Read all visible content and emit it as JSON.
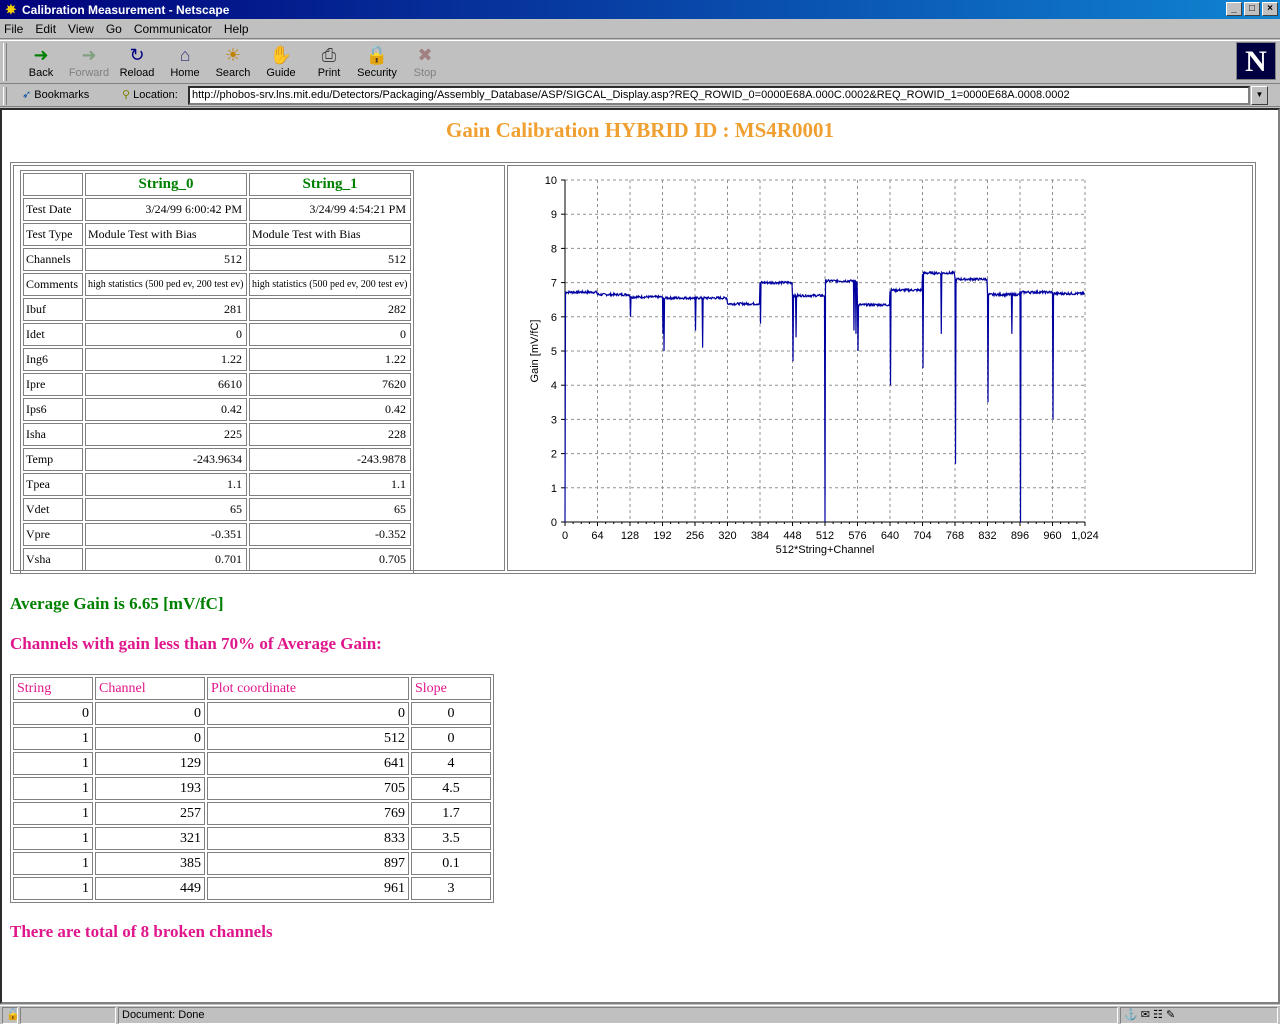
{
  "window": {
    "title": "Calibration Measurement - Netscape"
  },
  "menu": [
    "File",
    "Edit",
    "View",
    "Go",
    "Communicator",
    "Help"
  ],
  "toolbar": [
    {
      "label": "Back",
      "icon": "back-arrow-icon",
      "glyph": "➜",
      "color": "#008000",
      "enabled": true
    },
    {
      "label": "Forward",
      "icon": "forward-arrow-icon",
      "glyph": "➜",
      "color": "#80a080",
      "enabled": false
    },
    {
      "label": "Reload",
      "icon": "reload-icon",
      "glyph": "↻",
      "color": "#000080",
      "enabled": true
    },
    {
      "label": "Home",
      "icon": "home-icon",
      "glyph": "⌂",
      "color": "#404080",
      "enabled": true
    },
    {
      "label": "Search",
      "icon": "search-icon",
      "glyph": "☀",
      "color": "#c08000",
      "enabled": true
    },
    {
      "label": "Guide",
      "icon": "guide-icon",
      "glyph": "✋",
      "color": "#4060c0",
      "enabled": true
    },
    {
      "label": "Print",
      "icon": "print-icon",
      "glyph": "⎙",
      "color": "#404040",
      "enabled": true
    },
    {
      "label": "Security",
      "icon": "lock-icon",
      "glyph": "🔒",
      "color": "#c0a000",
      "enabled": true
    },
    {
      "label": "Stop",
      "icon": "stop-icon",
      "glyph": "✖",
      "color": "#a08080",
      "enabled": false
    }
  ],
  "location": {
    "bookmarks_label": "Bookmarks",
    "location_label": "Location:",
    "url": "http://phobos-srv.lns.mit.edu/Detectors/Packaging/Assembly_Database/ASP/SIGCAL_Display.asp?REQ_ROWID_0=0000E68A.000C.0002&REQ_ROWID_1=0000E68A.0008.0002"
  },
  "page": {
    "title": "Gain Calibration HYBRID ID : MS4R0001",
    "info_headers": [
      "String_0",
      "String_1"
    ],
    "info_rows": [
      {
        "label": "Test Date",
        "v0": "3/24/99 6:00:42 PM",
        "v1": "3/24/99 4:54:21 PM",
        "align": "right"
      },
      {
        "label": "Test Type",
        "v0": "Module Test with Bias",
        "v1": "Module Test with Bias",
        "align": "left"
      },
      {
        "label": "Channels",
        "v0": "512",
        "v1": "512",
        "align": "right"
      },
      {
        "label": "Comments",
        "v0": "high statistics (500 ped ev, 200 test ev)",
        "v1": "high statistics (500 ped ev, 200 test ev)",
        "align": "small"
      },
      {
        "label": "Ibuf",
        "v0": "281",
        "v1": "282",
        "align": "right"
      },
      {
        "label": "Idet",
        "v0": "0",
        "v1": "0",
        "align": "right"
      },
      {
        "label": "Ing6",
        "v0": "1.22",
        "v1": "1.22",
        "align": "right"
      },
      {
        "label": "Ipre",
        "v0": "6610",
        "v1": "7620",
        "align": "right"
      },
      {
        "label": "Ips6",
        "v0": "0.42",
        "v1": "0.42",
        "align": "right"
      },
      {
        "label": "Isha",
        "v0": "225",
        "v1": "228",
        "align": "right"
      },
      {
        "label": "Temp",
        "v0": "-243.9634",
        "v1": "-243.9878",
        "align": "right"
      },
      {
        "label": "Tpea",
        "v0": "1.1",
        "v1": "1.1",
        "align": "right"
      },
      {
        "label": "Vdet",
        "v0": "65",
        "v1": "65",
        "align": "right"
      },
      {
        "label": "Vpre",
        "v0": "-0.351",
        "v1": "-0.352",
        "align": "right"
      },
      {
        "label": "Vsha",
        "v0": "0.701",
        "v1": "0.705",
        "align": "right"
      }
    ],
    "average": "Average Gain is 6.65 [mV/fC]",
    "low_header": "Channels with gain less than 70% of Average Gain:",
    "low_columns": [
      "String",
      "Channel",
      "Plot coordinate",
      "Slope"
    ],
    "low_rows": [
      [
        "0",
        "0",
        "0",
        "0"
      ],
      [
        "1",
        "0",
        "512",
        "0"
      ],
      [
        "1",
        "129",
        "641",
        "4"
      ],
      [
        "1",
        "193",
        "705",
        "4.5"
      ],
      [
        "1",
        "257",
        "769",
        "1.7"
      ],
      [
        "1",
        "321",
        "833",
        "3.5"
      ],
      [
        "1",
        "385",
        "897",
        "0.1"
      ],
      [
        "1",
        "449",
        "961",
        "3"
      ]
    ],
    "total": "There are total of 8 broken channels"
  },
  "status": {
    "text": "Document: Done"
  },
  "chart_data": {
    "type": "line",
    "xlabel": "512*String+Channel",
    "ylabel": "Gain [mV/fC]",
    "xlim": [
      0,
      1024
    ],
    "ylim": [
      0,
      10
    ],
    "xticks": [
      "0",
      "64",
      "128",
      "192",
      "256",
      "320",
      "384",
      "448",
      "512",
      "576",
      "640",
      "704",
      "768",
      "832",
      "896",
      "960",
      "1,024"
    ],
    "yticks": [
      "0",
      "1",
      "2",
      "3",
      "4",
      "5",
      "6",
      "7",
      "8",
      "9",
      "10"
    ],
    "grid": true,
    "line_color": "#0000a0",
    "segments": [
      {
        "x": [
          0,
          63
        ],
        "y": 6.72
      },
      {
        "x": [
          64,
          127
        ],
        "y": 6.65
      },
      {
        "x": [
          128,
          191
        ],
        "y": 6.58
      },
      {
        "x": [
          192,
          255
        ],
        "y": 6.55
      },
      {
        "x": [
          256,
          319
        ],
        "y": 6.55
      },
      {
        "x": [
          320,
          383
        ],
        "y": 6.38
      },
      {
        "x": [
          384,
          447
        ],
        "y": 7.0
      },
      {
        "x": [
          448,
          511
        ],
        "y": 6.62
      },
      {
        "x": [
          512,
          575
        ],
        "y": 7.05
      },
      {
        "x": [
          576,
          639
        ],
        "y": 6.35
      },
      {
        "x": [
          640,
          703
        ],
        "y": 6.78
      },
      {
        "x": [
          704,
          767
        ],
        "y": 7.28
      },
      {
        "x": [
          768,
          831
        ],
        "y": 7.1
      },
      {
        "x": [
          832,
          895
        ],
        "y": 6.65
      },
      {
        "x": [
          896,
          959
        ],
        "y": 6.72
      },
      {
        "x": [
          960,
          1023
        ],
        "y": 6.68
      }
    ],
    "dips": [
      {
        "x": 0,
        "y": 0
      },
      {
        "x": 129,
        "y": 6.0
      },
      {
        "x": 193,
        "y": 5.5
      },
      {
        "x": 195,
        "y": 5.0
      },
      {
        "x": 257,
        "y": 5.6
      },
      {
        "x": 271,
        "y": 5.1
      },
      {
        "x": 385,
        "y": 5.8
      },
      {
        "x": 449,
        "y": 4.7
      },
      {
        "x": 455,
        "y": 5.4
      },
      {
        "x": 512,
        "y": 0
      },
      {
        "x": 569,
        "y": 5.6
      },
      {
        "x": 573,
        "y": 5.5
      },
      {
        "x": 577,
        "y": 5.0
      },
      {
        "x": 641,
        "y": 4.0
      },
      {
        "x": 705,
        "y": 4.5
      },
      {
        "x": 741,
        "y": 5.5
      },
      {
        "x": 769,
        "y": 1.7
      },
      {
        "x": 833,
        "y": 3.5
      },
      {
        "x": 880,
        "y": 5.5
      },
      {
        "x": 897,
        "y": 0.0
      },
      {
        "x": 961,
        "y": 3.0
      }
    ]
  }
}
